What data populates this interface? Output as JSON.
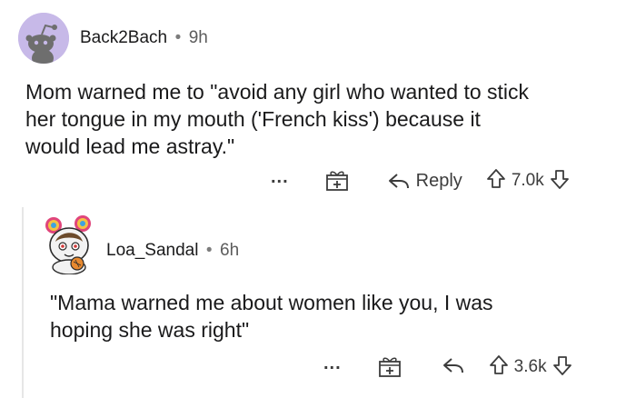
{
  "comments": [
    {
      "username": "Back2Bach",
      "separator": "•",
      "time": "9h",
      "body_lines": [
        "Mom warned me to \"avoid any girl who wanted to stick",
        "her tongue in my mouth ('French kiss') because it",
        "would lead me astray.\""
      ],
      "actions": {
        "more": "...",
        "reply_label": "Reply",
        "score": "7.0k"
      }
    },
    {
      "username": "Loa_Sandal",
      "separator": "•",
      "time": "6h",
      "body_lines": [
        "\"Mama warned me about women like you, I was",
        "hoping she was right\""
      ],
      "actions": {
        "more": "...",
        "score": "3.6k"
      }
    }
  ],
  "icons": {
    "avatar1": "reddit-snoo-avatar-icon",
    "avatar2": "cartoon-user-avatar-icon",
    "award": "gift-award-icon",
    "reply": "reply-arrow-icon",
    "upvote": "upvote-arrow-icon",
    "downvote": "downvote-arrow-icon"
  },
  "colors": {
    "avatar_bg": "#c7b9e8",
    "text": "#1a1a1b",
    "muted": "#5c5c5c"
  }
}
